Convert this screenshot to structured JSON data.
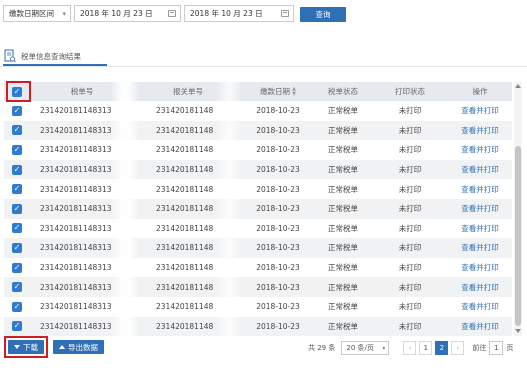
{
  "filter": {
    "range_type": "缴款日期区间",
    "start_date": "2018 年 10 月 23 日",
    "end_date": "2018 年 10 月 23 日",
    "query_label": "查询"
  },
  "tab": {
    "label": "税单信息查询结果"
  },
  "table": {
    "headers": [
      "税单号",
      "报关单号",
      "缴款日期",
      "税单状态",
      "打印状态",
      "操作"
    ],
    "rows": [
      {
        "tax_no": "231420181148313",
        "customs_no": "231420181148",
        "date": "2018-10-23",
        "status": "正常税单",
        "print": "未打印",
        "action": "查看并打印"
      },
      {
        "tax_no": "231420181148313",
        "customs_no": "231420181148",
        "date": "2018-10-23",
        "status": "正常税单",
        "print": "未打印",
        "action": "查看并打印"
      },
      {
        "tax_no": "231420181148313",
        "customs_no": "231420181148",
        "date": "2018-10-23",
        "status": "正常税单",
        "print": "未打印",
        "action": "查看并打印"
      },
      {
        "tax_no": "231420181148313",
        "customs_no": "231420181148",
        "date": "2018-10-23",
        "status": "正常税单",
        "print": "未打印",
        "action": "查看并打印"
      },
      {
        "tax_no": "231420181148313",
        "customs_no": "231420181148",
        "date": "2018-10-23",
        "status": "正常税单",
        "print": "未打印",
        "action": "查看并打印"
      },
      {
        "tax_no": "231420181148313",
        "customs_no": "231420181148",
        "date": "2018-10-23",
        "status": "正常税单",
        "print": "未打印",
        "action": "查看并打印"
      },
      {
        "tax_no": "231420181148313",
        "customs_no": "231420181148",
        "date": "2018-10-23",
        "status": "正常税单",
        "print": "未打印",
        "action": "查看并打印"
      },
      {
        "tax_no": "231420181148313",
        "customs_no": "231420181148",
        "date": "2018-10-23",
        "status": "正常税单",
        "print": "未打印",
        "action": "查看并打印"
      },
      {
        "tax_no": "231420181148313",
        "customs_no": "231420181148",
        "date": "2018-10-23",
        "status": "正常税单",
        "print": "未打印",
        "action": "查看并打印"
      },
      {
        "tax_no": "231420181148313",
        "customs_no": "231420181148",
        "date": "2018-10-23",
        "status": "正常税单",
        "print": "未打印",
        "action": "查看并打印"
      },
      {
        "tax_no": "231420181148313",
        "customs_no": "231420181148",
        "date": "2018-10-23",
        "status": "正常税单",
        "print": "未打印",
        "action": "查看并打印"
      },
      {
        "tax_no": "231420181148313",
        "customs_no": "231420181148",
        "date": "2018-10-23",
        "status": "正常税单",
        "print": "未打印",
        "action": "查看并打印"
      }
    ]
  },
  "footer": {
    "download_label": "下载",
    "export_label": "导出数据",
    "total_label": "共 29 条",
    "page_size": "20 条/页",
    "pages": [
      "1",
      "2"
    ],
    "current_page": "2",
    "prev_icon": "‹",
    "next_icon": "›",
    "goto_label": "前往",
    "goto_value": "1",
    "page_suffix": "页"
  },
  "colors": {
    "accent": "#2e6fb6",
    "checkbox": "#2e7bd0",
    "highlight": "#d21c24",
    "header_bg": "#e6eaf0"
  }
}
